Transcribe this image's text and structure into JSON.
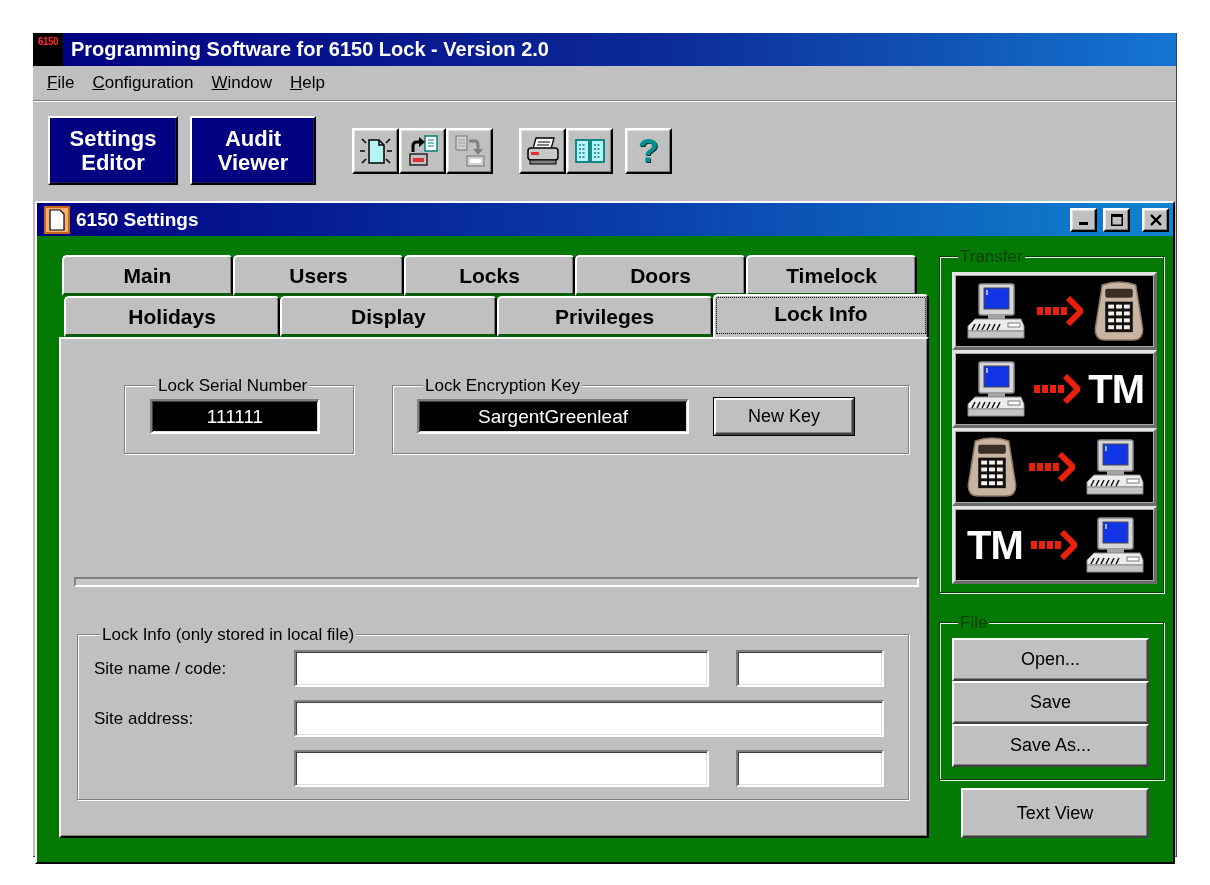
{
  "window": {
    "logo": "6150",
    "title": "Programming Software for 6150 Lock - Version 2.0"
  },
  "menu": [
    {
      "label": "File"
    },
    {
      "label": "Configuration"
    },
    {
      "label": "Window"
    },
    {
      "label": "Help"
    }
  ],
  "toolbar": {
    "views": [
      {
        "label": "Settings Editor"
      },
      {
        "label": "Audit Viewer"
      }
    ],
    "tool_groups": [
      [
        {
          "kind": "new-document",
          "disabled": false
        },
        {
          "kind": "export",
          "disabled": false
        },
        {
          "kind": "import",
          "disabled": true
        }
      ],
      [
        {
          "kind": "print",
          "disabled": false
        },
        {
          "kind": "columns",
          "disabled": false
        }
      ],
      [
        {
          "kind": "help",
          "text": "?",
          "disabled": false
        }
      ]
    ]
  },
  "settings_window": {
    "title": "6150 Settings",
    "tabs": [
      [
        {
          "label": "Main",
          "selected": false
        },
        {
          "label": "Users",
          "selected": false
        },
        {
          "label": "Locks",
          "selected": false
        },
        {
          "label": "Doors",
          "selected": false
        },
        {
          "label": "Timelock",
          "selected": false
        }
      ],
      [
        {
          "label": "Holidays",
          "selected": false
        },
        {
          "label": "Display",
          "selected": false
        },
        {
          "label": "Privileges",
          "selected": false
        },
        {
          "label": "Lock Info",
          "selected": true
        }
      ]
    ],
    "serial_group": {
      "label": "Lock Serial Number",
      "value": "111111"
    },
    "key_group": {
      "label": "Lock Encryption Key",
      "value": "SargentGreenleaf",
      "button": "New Key"
    },
    "info_group": {
      "label": "Lock Info (only stored in local file)",
      "rows": [
        {
          "kind": "split",
          "label": "Site name / code:"
        },
        {
          "kind": "full",
          "label": "Site address:"
        },
        {
          "kind": "split"
        }
      ]
    },
    "transfer": {
      "label": "Transfer",
      "buttons": [
        {
          "from": {
            "kind": "computer"
          },
          "to": {
            "kind": "lock"
          }
        },
        {
          "from": {
            "kind": "computer"
          },
          "to": {
            "kind": "text",
            "text": "TM"
          }
        },
        {
          "from": {
            "kind": "lock"
          },
          "to": {
            "kind": "computer"
          }
        },
        {
          "from": {
            "kind": "text",
            "text": "TM"
          },
          "to": {
            "kind": "computer"
          }
        }
      ]
    },
    "file": {
      "label": "File",
      "buttons": [
        "Open...",
        "Save",
        "Save As..."
      ]
    },
    "text_view_button": "Text View"
  }
}
